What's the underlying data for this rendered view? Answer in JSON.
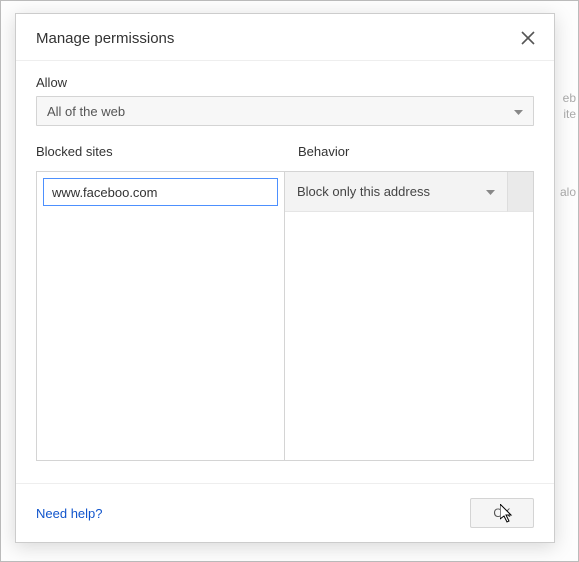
{
  "dialog": {
    "title": "Manage permissions",
    "allow_label": "Allow",
    "allow_value": "All of the web",
    "blocked_label": "Blocked sites",
    "behavior_label": "Behavior",
    "site_input_value": "www.faceboo.com",
    "behavior_value": "Block only this address",
    "help_link": "Need help?",
    "ok_label": "OK"
  },
  "background": {
    "frag1": "eb",
    "frag2": "ite",
    "frag3": "alo"
  }
}
